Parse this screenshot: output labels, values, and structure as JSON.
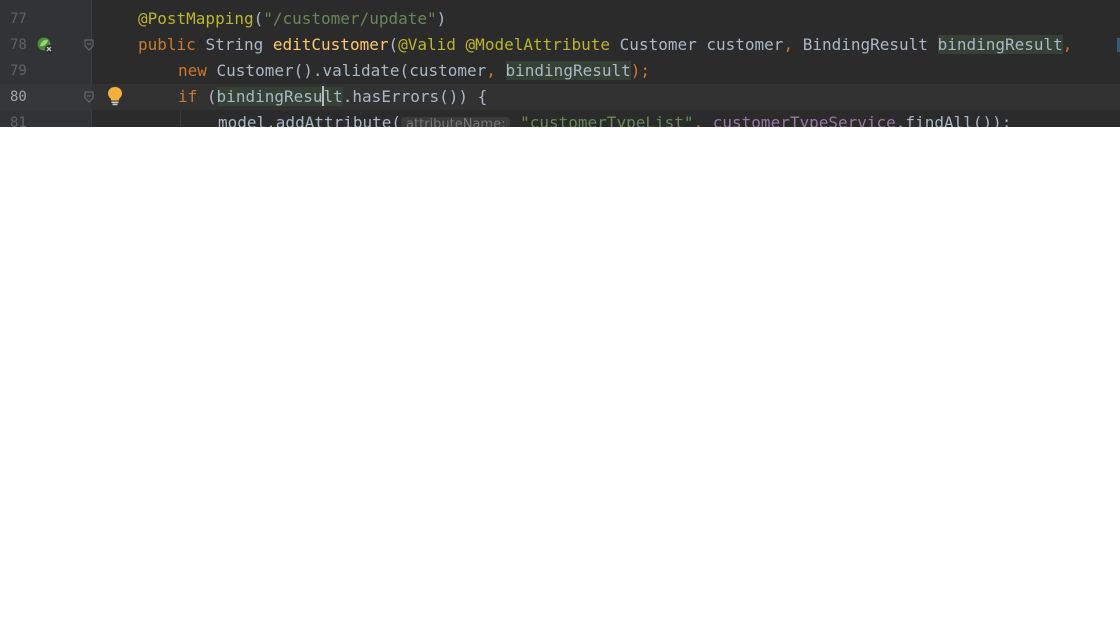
{
  "editor": {
    "lines": [
      {
        "number": "77",
        "tokens": [
          {
            "t": "@PostMapping",
            "k": "ann"
          },
          {
            "t": "(",
            "k": "plain"
          },
          {
            "t": "\"/customer/update\"",
            "k": "str"
          },
          {
            "t": ")",
            "k": "plain"
          }
        ]
      },
      {
        "number": "78",
        "tokens": [
          {
            "t": "public ",
            "k": "kw"
          },
          {
            "t": "String ",
            "k": "plain"
          },
          {
            "t": "editCustomer",
            "k": "fn"
          },
          {
            "t": "(",
            "k": "plain"
          },
          {
            "t": "@Valid ",
            "k": "ann"
          },
          {
            "t": "@ModelAttribute ",
            "k": "ann"
          },
          {
            "t": "Customer customer",
            "k": "plain"
          },
          {
            "t": ", ",
            "k": "kw"
          },
          {
            "t": "BindingResult ",
            "k": "plain"
          },
          {
            "t": "bindingResult",
            "k": "plain",
            "hl": true
          },
          {
            "t": ", ",
            "k": "kw"
          }
        ]
      },
      {
        "number": "79",
        "tokens": [
          {
            "t": "new ",
            "k": "kw"
          },
          {
            "t": "Customer().validate(customer",
            "k": "plain"
          },
          {
            "t": ", ",
            "k": "kw"
          },
          {
            "t": "bindingResult",
            "k": "plain",
            "hl": true
          },
          {
            "t": ");",
            "k": "kw"
          }
        ]
      },
      {
        "number": "80",
        "tokens": [
          {
            "t": "if ",
            "k": "kw"
          },
          {
            "t": "(",
            "k": "plain"
          },
          {
            "t": "bindingResu",
            "k": "plain",
            "hl": true
          },
          {
            "t": "CARET",
            "k": "caret"
          },
          {
            "t": "lt",
            "k": "plain",
            "hl": true
          },
          {
            "t": ".hasErrors()) {",
            "k": "plain"
          }
        ]
      },
      {
        "number": "81",
        "tokens": [
          {
            "t": "model.addAttribute(",
            "k": "plain"
          },
          {
            "t": "attributeName:",
            "k": "hint"
          },
          {
            "t": " ",
            "k": "plain"
          },
          {
            "t": "\"customerTypeList\"",
            "k": "str"
          },
          {
            "t": ", ",
            "k": "kw"
          },
          {
            "t": "customerTypeService",
            "k": "fld"
          },
          {
            "t": ".findAll());",
            "k": "plain"
          }
        ]
      }
    ],
    "icons": {
      "bean": "spring-bean-icon",
      "bulb": "intention-bulb-icon",
      "fold": "fold-icon"
    },
    "colors": {
      "background": "#2b2b2b",
      "annotation": "#bbb529",
      "string": "#6a8759",
      "keyword": "#cc7832",
      "method": "#ffc66d",
      "field": "#9876aa",
      "text": "#a9b7c6"
    }
  }
}
